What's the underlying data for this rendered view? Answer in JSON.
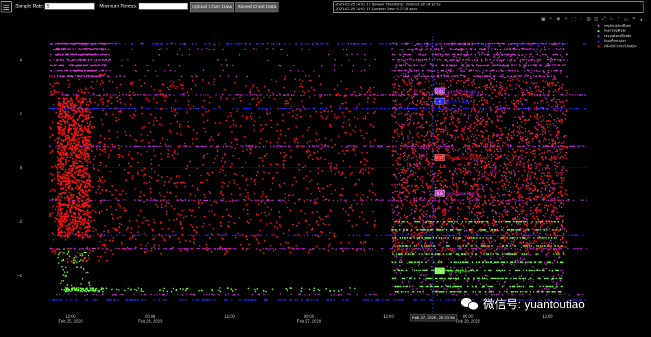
{
  "toolbar": {
    "sample_rate_label": "Sample Rate:",
    "sample_rate_value": "5",
    "min_fitness_label": "Minimum Fitness:",
    "min_fitness_value": "",
    "upload_button": "Upload Chart Data",
    "stored_button": "Stored Chart Data"
  },
  "log": {
    "line1": "2020-02-28 14:51:17 Newest Timestamp: 2020-02-28 14:12:52",
    "line2": "2020-02-28 14:51:17 Erection Time: 5.2718 secs"
  },
  "modebar_icons": [
    "camera-icon",
    "zoom-icon",
    "pan-icon",
    "plus-icon",
    "box-select-icon",
    "lasso-icon",
    "zoom-in-icon",
    "zoom-out-icon",
    "autoscale-icon",
    "reset-axes-icon",
    "spike-icon",
    "hover-closest-icon",
    "hover-compare-icon",
    "plotly-logo-icon"
  ],
  "colors": {
    "explorationRate": "#cc33cc",
    "learningRate": "#66ff33",
    "unrealizedScale": "#aa22dd",
    "lossAversion": "#2222ff",
    "NFoldCrossSharpe": "#ff1111"
  },
  "hover": {
    "x_label": "Feb 27, 2020, 20:21:55",
    "labels": [
      {
        "value": "0.81",
        "name": "unrealizedScale",
        "series": "unrealizedScale"
      },
      {
        "value": "4",
        "name": "lossAversion",
        "series": "lossAversion"
      },
      {
        "value": "0.17",
        "name": "NFoldCrossSharpe",
        "series": "NFoldCrossSharpe"
      },
      {
        "value": "0.6",
        "name": "explorationRate",
        "series": "explorationRate"
      },
      {
        "value": "0.001",
        "name": "learningRate",
        "series": "learningRate"
      }
    ]
  },
  "watermark": "微信号: yuantoutiao",
  "chart_data": {
    "type": "scatter",
    "title": "",
    "xlabel": "",
    "ylabel": "",
    "ylim": [
      -4.9,
      4.9
    ],
    "grid": false,
    "legend_placement": "top-right",
    "y_ticks": [
      4,
      2,
      0,
      -2,
      -4
    ],
    "y_tick_labels": [
      "4",
      "2",
      "0",
      "−2",
      "−4"
    ],
    "x_ticks": [
      {
        "line1": "12:00",
        "line2": "Feb 25, 2020",
        "t": 0.0
      },
      {
        "line1": "00:00",
        "line2": "Feb 26, 2020",
        "t": 12.0
      },
      {
        "line1": "12:00",
        "line2": "",
        "t": 24.0
      },
      {
        "line1": "00:00",
        "line2": "Feb 27, 2020",
        "t": 36.0
      },
      {
        "line1": "12:00",
        "line2": "",
        "t": 48.0
      },
      {
        "line1": "00:00",
        "line2": "Feb 28, 2020",
        "t": 60.0
      },
      {
        "line1": "12:00",
        "line2": "",
        "t": 72.0
      }
    ],
    "series": [
      {
        "name": "explorationRate",
        "levels": [
          4.6,
          4.4,
          4.2,
          4.0,
          3.8,
          3.6,
          3.4,
          2.7,
          0.8,
          -1.2,
          -3.0,
          -4.7
        ]
      },
      {
        "name": "learningRate",
        "levels": [
          -2.0,
          -2.3,
          -2.6,
          -2.9,
          -3.2,
          -3.5,
          -3.8,
          -4.1,
          -4.4,
          -4.6
        ]
      },
      {
        "name": "unrealizedScale",
        "levels": [
          2.7,
          0.8,
          -1.2,
          -3.0
        ]
      },
      {
        "name": "lossAversion",
        "levels": [
          4.6,
          2.2,
          -2.5,
          -4.9
        ]
      },
      {
        "name": "NFoldCrossSharpe",
        "range": [
          -3.5,
          3.0
        ]
      }
    ]
  }
}
